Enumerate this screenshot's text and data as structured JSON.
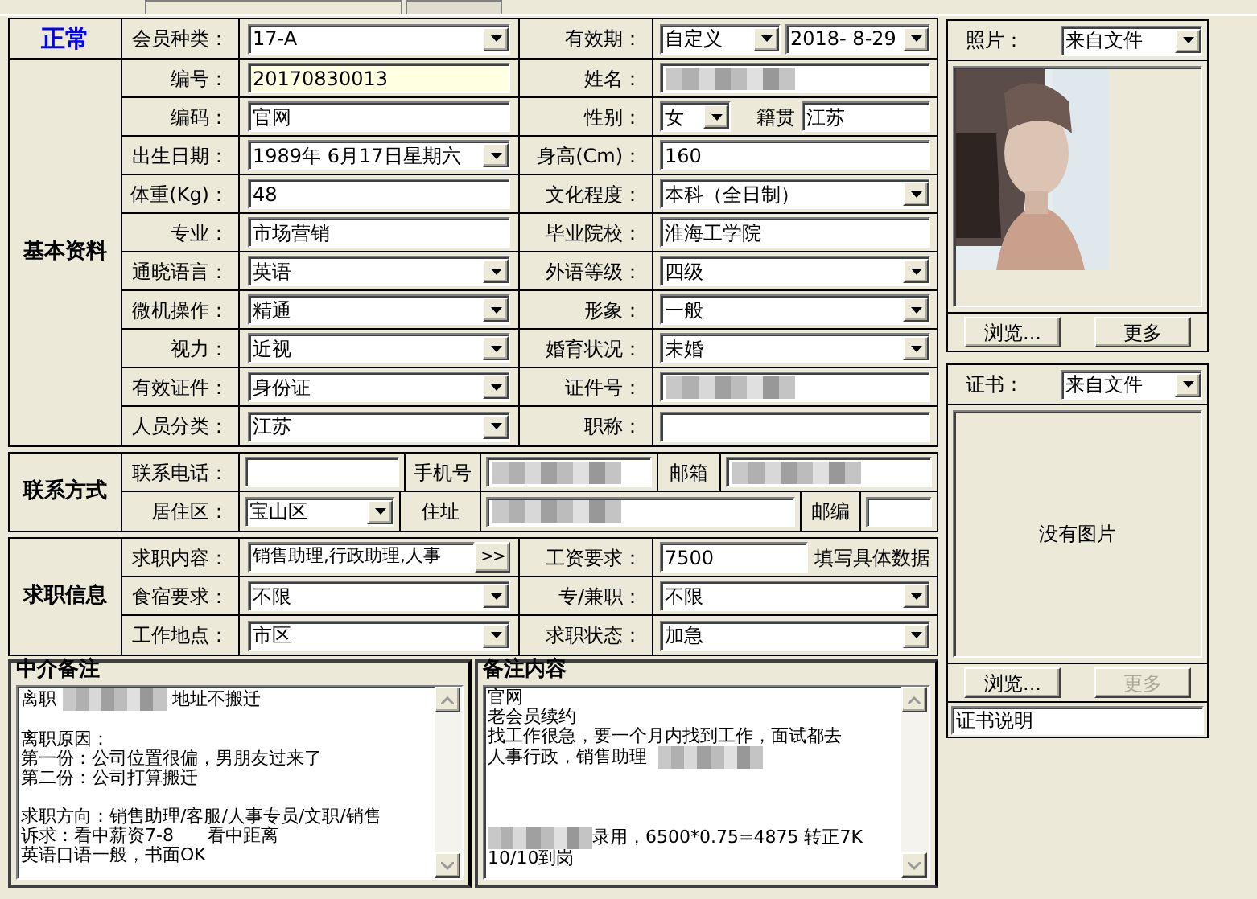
{
  "status": {
    "text": "正常"
  },
  "header": {
    "member_type": {
      "label": "会员种类：",
      "kind": "select",
      "value": "17-A"
    },
    "validity": {
      "label": "有效期：",
      "mode": "自定义",
      "date": "2018- 8-29"
    }
  },
  "basic": {
    "title": "基本资料",
    "rows": [
      {
        "left": {
          "label": "编号：",
          "kind": "text",
          "value": "20170830013",
          "highlighted": true
        },
        "right": {
          "label": "姓名：",
          "kind": "redacted"
        }
      },
      {
        "left": {
          "label": "编码：",
          "kind": "text",
          "value": "官网"
        },
        "right": {
          "label": "性别：",
          "kind": "gender",
          "value": "女",
          "extra_label": "籍贯",
          "extra_value": "江苏"
        }
      },
      {
        "left": {
          "label": "出生日期：",
          "kind": "select",
          "value": "1989年 6月17日星期六"
        },
        "right": {
          "label": "身高(Cm)：",
          "kind": "text",
          "value": "160"
        }
      },
      {
        "left": {
          "label": "体重(Kg)：",
          "kind": "text",
          "value": "48"
        },
        "right": {
          "label": "文化程度：",
          "kind": "select",
          "value": "本科（全日制）"
        }
      },
      {
        "left": {
          "label": "专业：",
          "kind": "text",
          "value": "市场营销"
        },
        "right": {
          "label": "毕业院校：",
          "kind": "text",
          "value": "淮海工学院"
        }
      },
      {
        "left": {
          "label": "通晓语言：",
          "kind": "select",
          "value": "英语"
        },
        "right": {
          "label": "外语等级：",
          "kind": "select",
          "value": "四级"
        }
      },
      {
        "left": {
          "label": "微机操作：",
          "kind": "select",
          "value": "精通"
        },
        "right": {
          "label": "形象：",
          "kind": "select",
          "value": "一般"
        }
      },
      {
        "left": {
          "label": "视力：",
          "kind": "select",
          "value": "近视"
        },
        "right": {
          "label": "婚育状况：",
          "kind": "select",
          "value": "未婚"
        }
      },
      {
        "left": {
          "label": "有效证件：",
          "kind": "select",
          "value": "身份证"
        },
        "right": {
          "label": "证件号：",
          "kind": "redacted"
        }
      },
      {
        "left": {
          "label": "人员分类：",
          "kind": "select",
          "value": "江苏"
        },
        "right": {
          "label": "职称：",
          "kind": "text"
        }
      }
    ]
  },
  "contact": {
    "title": "联系方式",
    "rows": [
      [
        {
          "label": "联系电话：",
          "kind": "text"
        },
        {
          "label": "手机号",
          "kind": "redacted"
        },
        {
          "label": "邮箱",
          "kind": "redacted"
        }
      ],
      [
        {
          "label": "居住区：",
          "kind": "select",
          "value": "宝山区"
        },
        {
          "label": "住址",
          "kind": "redacted"
        },
        {
          "label": "邮编",
          "kind": "text"
        }
      ]
    ]
  },
  "job": {
    "title": "求职信息",
    "rows": [
      {
        "left": {
          "label": "求职内容：",
          "kind": "more",
          "value": "销售助理,行政助理,人事",
          "button": ">>"
        },
        "right": {
          "label": "工资要求：",
          "kind": "hint",
          "value": "7500",
          "hint": "填写具体数据"
        }
      },
      {
        "left": {
          "label": "食宿要求：",
          "kind": "select",
          "value": "不限"
        },
        "right": {
          "label": "专/兼职：",
          "kind": "select",
          "value": "不限"
        }
      },
      {
        "left": {
          "label": "工作地点：",
          "kind": "select",
          "value": "市区"
        },
        "right": {
          "label": "求职状态：",
          "kind": "select",
          "value": "加急"
        }
      }
    ]
  },
  "notes": [
    {
      "title": "中介备注",
      "paragraphs": [
        [
          [
            "离职 ",
            {
              "kind": "redacted"
            },
            " 地址不搬迁"
          ]
        ],
        [
          "离职原因：",
          "第一份：公司位置很偏，男朋友过来了",
          "第二份：公司打算搬迁"
        ],
        [
          "求职方向：销售助理/客服/人事专员/文职/销售",
          "诉求：看中薪资7-8      看中距离",
          "英语口语一般，书面OK"
        ]
      ]
    },
    {
      "title": "备注内容",
      "paragraphs": [
        [
          "官网",
          "老会员续约",
          "找工作很急，要一个月内找到工作，面试都去",
          [
            "人事行政，销售助理  ",
            {
              "kind": "redacted"
            }
          ]
        ],
        [
          [
            {
              "kind": "redacted"
            },
            "录用，6500*0.75=4875 转正7K"
          ],
          "10/10到岗"
        ]
      ]
    }
  ],
  "photo": {
    "label": "照片：",
    "source": "来自文件",
    "buttons": [
      {
        "label": "浏览...",
        "disabled": false
      },
      {
        "label": "更多",
        "disabled": false
      }
    ]
  },
  "certificate": {
    "label": "证书：",
    "source": "来自文件",
    "empty_text": "没有图片",
    "buttons": [
      {
        "label": "浏览...",
        "disabled": false
      },
      {
        "label": "更多",
        "disabled": true
      }
    ],
    "caption": "证书说明"
  }
}
